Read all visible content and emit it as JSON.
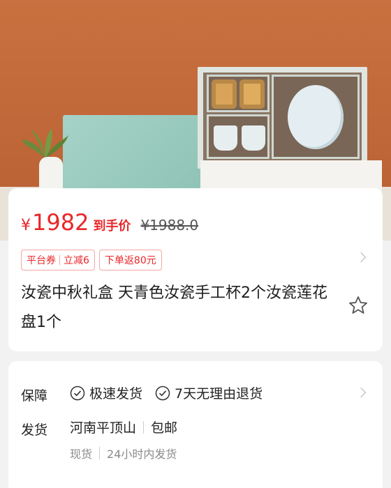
{
  "product_image": {
    "alt": "汝瓷中秋礼盒"
  },
  "price": {
    "currency": "¥",
    "amount": "1982",
    "label": "到手价",
    "original": "¥1988.0"
  },
  "promo_tags": [
    {
      "left": "平台券",
      "right": "立减6"
    },
    {
      "text": "下单返80元"
    }
  ],
  "title": "汝瓷中秋礼盒 天青色汝瓷手工杯2个汝瓷莲花盘1个",
  "service": {
    "guarantee_label": "保障",
    "guarantees": [
      "极速发货",
      "7天无理由退货"
    ],
    "ship_label": "发货",
    "origin": "河南平顶山",
    "shipping_fee": "包邮",
    "stock": "现货",
    "dispatch": "24小时内发货"
  },
  "colors": {
    "accent": "#e8272a"
  },
  "icons": {
    "favorite": "star-icon",
    "guarantee": "check-circle-icon",
    "more": "chevron-right-icon"
  }
}
